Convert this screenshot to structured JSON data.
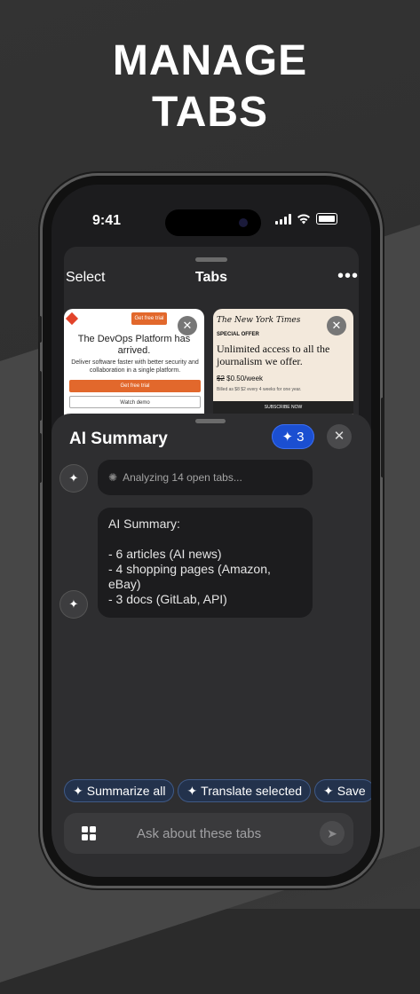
{
  "headline": {
    "line1": "MANAGE",
    "line2": "TABS"
  },
  "status_bar": {
    "time": "9:41"
  },
  "tabs_sheet": {
    "select_label": "Select",
    "title": "Tabs",
    "more_label": "•••",
    "cards": [
      {
        "name": "gitlab",
        "cta_small": "Get free trial",
        "headline": "The DevOps Platform has arrived.",
        "body": "Deliver software faster with better security and collaboration in a single platform.",
        "primary_button": "Get free trial",
        "secondary_button": "Watch demo"
      },
      {
        "name": "nytimes",
        "logo": "The New York Times",
        "special": "SPECIAL OFFER",
        "headline": "Unlimited access to all the journalism we offer.",
        "price_old": "$2",
        "price": "$0.50/week",
        "fine": "Billed as $8 $2 every 4 weeks for one year.",
        "button": "SUBSCRIBE NOW"
      }
    ]
  },
  "ai_sheet": {
    "title": "AI Summary",
    "badge_count": "3",
    "close_label": "✕",
    "analyzing": "Analyzing 14 open tabs...",
    "summary_title": "AI Summary:",
    "summary_items": [
      "- 6 articles (AI news)",
      "- 4 shopping pages (Amazon, eBay)",
      "- 3 docs (GitLab, API)"
    ],
    "chips": [
      "Summarize all",
      "Translate selected",
      "Save"
    ],
    "input_placeholder": "Ask about these tabs"
  },
  "colors": {
    "accent_blue": "#1b4fd1",
    "gitlab_orange": "#e2682c"
  }
}
